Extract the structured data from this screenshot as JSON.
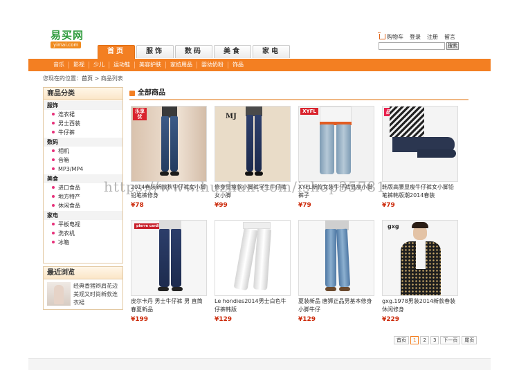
{
  "logo": {
    "cn": "易买网",
    "en": "yimai.com"
  },
  "top_links": {
    "cart": "购物车",
    "login": "登录",
    "register": "注册",
    "message": "留言"
  },
  "search": {
    "placeholder": "",
    "button": "搜索"
  },
  "tabs": [
    {
      "label": "首页",
      "active": true
    },
    {
      "label": "服饰",
      "active": false
    },
    {
      "label": "数码",
      "active": false
    },
    {
      "label": "美食",
      "active": false
    },
    {
      "label": "家电",
      "active": false
    }
  ],
  "subnav": [
    "音乐",
    "影视",
    "少儿",
    "运动鞋",
    "美容护肤",
    "家纺用品",
    "婴幼奶粉",
    "饰品"
  ],
  "breadcrumb": {
    "prefix": "您现在的位置：",
    "home": "首页",
    "sep": " > ",
    "current": "商品列表"
  },
  "categories": {
    "title": "商品分类",
    "groups": [
      {
        "name": "服饰",
        "items": [
          "连衣裙",
          "男士西装",
          "牛仔裤"
        ]
      },
      {
        "name": "数码",
        "items": [
          "相机",
          "音箱",
          "MP3/MP4"
        ]
      },
      {
        "name": "美食",
        "items": [
          "进口食品",
          "地方特产",
          "休闲食品"
        ]
      },
      {
        "name": "家电",
        "items": [
          "平板电视",
          "洗衣机",
          "冰箱"
        ]
      }
    ]
  },
  "recent": {
    "title": "最近浏览",
    "items": [
      {
        "text": "经典香猪辫肩花边美观又时尚新款连衣裙"
      }
    ]
  },
  "content": {
    "title": "全部商品"
  },
  "products": [
    {
      "name": "2014春装新款秋牛仔裤女小脚铅笔裤修身",
      "price": "¥78",
      "badge": "乐享优"
    },
    {
      "name": "修身显瘦款小脚裤学生牛仔裤女小脚",
      "price": "¥99",
      "badge": "MJ"
    },
    {
      "name": "XYFL新款女装牛仔裤显瘦小脚裤子",
      "price": "¥79",
      "badge": "XYFL"
    },
    {
      "name": "韩版高腰显瘦牛仔裤女小脚铅笔裤韩版潮2014春装",
      "price": "¥79",
      "badge": "品牌"
    },
    {
      "name": "皮尔卡丹 男士牛仔裤 男 直筒 春夏新品",
      "price": "¥199",
      "badge": "pierre cardin"
    },
    {
      "name": "Le hondies2014男士白色牛仔裤韩版",
      "price": "¥129",
      "badge": ""
    },
    {
      "name": "夏装新品 唐狮正品男基本修身小脚牛仔",
      "price": "¥129",
      "badge": ""
    },
    {
      "name": "gxg.1978男装2014新款春装休闲修身",
      "price": "¥229",
      "badge": "gxg"
    }
  ],
  "pagination": {
    "first": "首页",
    "pages": [
      "1",
      "2",
      "3"
    ],
    "next": "下一页",
    "last": "尾页"
  },
  "watermark": "https://www.huzhan.com/ishop35781",
  "colors": {
    "accent": "#f37f22",
    "price": "#cc2a0a",
    "logo_green": "#2e9b3c"
  }
}
